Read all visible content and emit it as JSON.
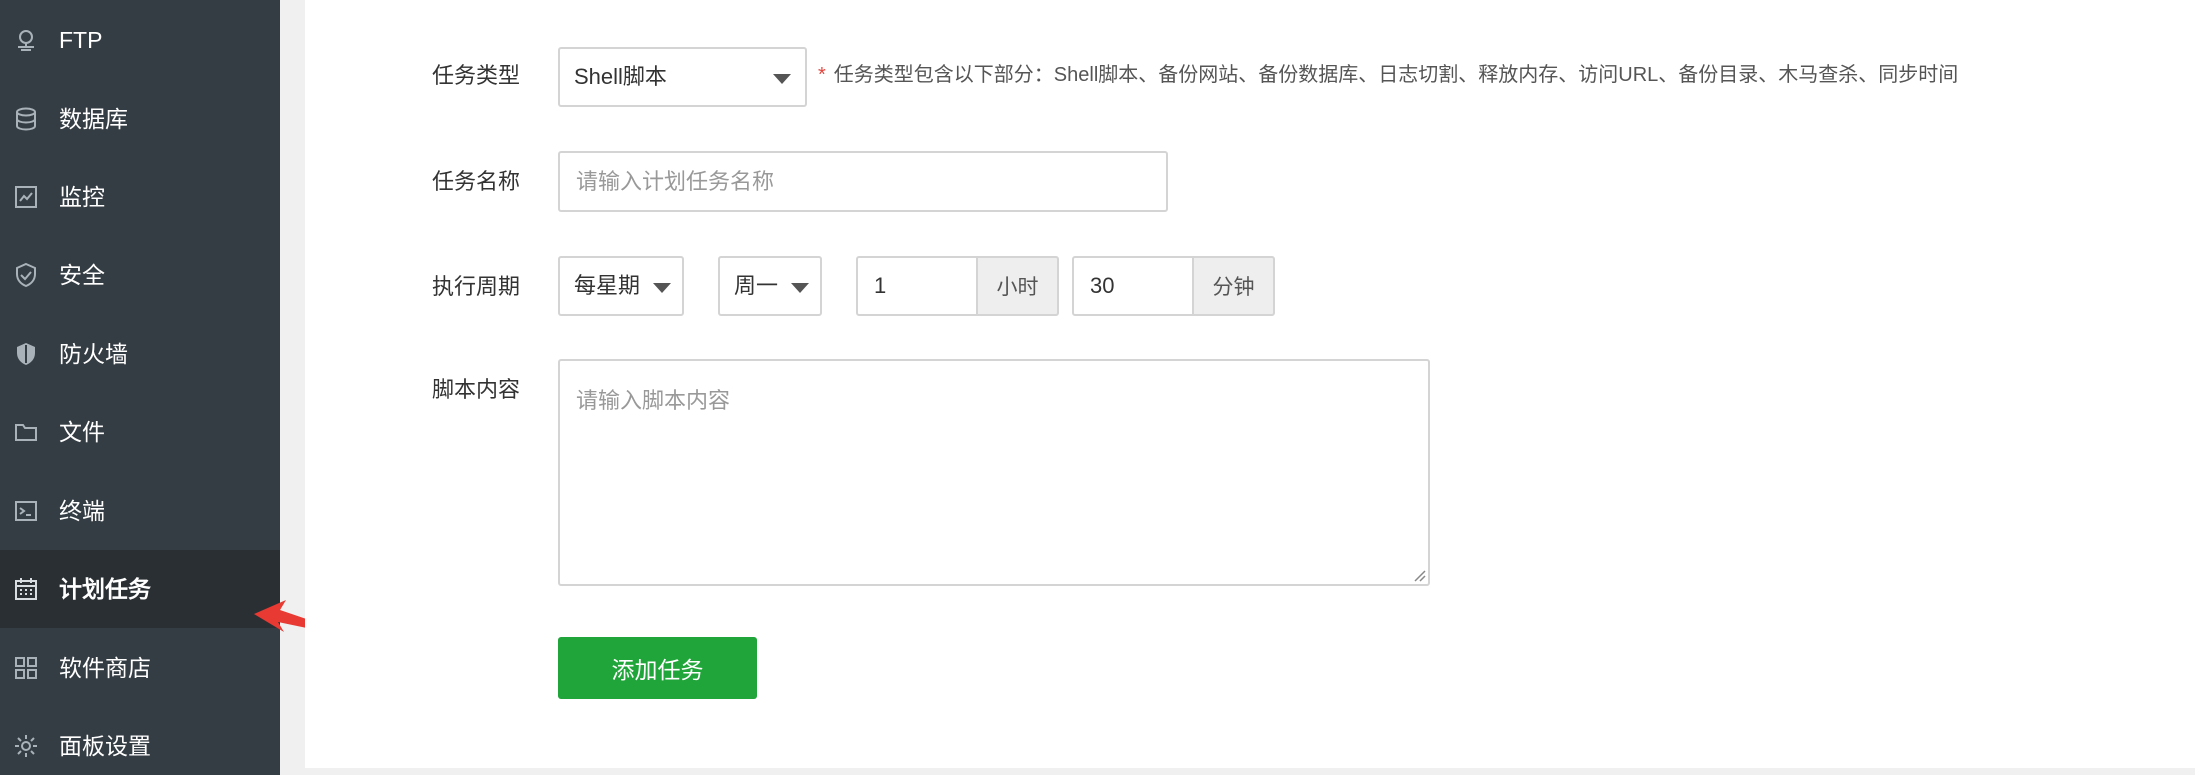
{
  "sidebar": {
    "items": [
      {
        "label": "FTP",
        "icon": "ftp-icon",
        "active": false
      },
      {
        "label": "数据库",
        "icon": "database-icon",
        "active": false
      },
      {
        "label": "监控",
        "icon": "monitor-icon",
        "active": false
      },
      {
        "label": "安全",
        "icon": "shield-check-icon",
        "active": false
      },
      {
        "label": "防火墙",
        "icon": "firewall-icon",
        "active": false
      },
      {
        "label": "文件",
        "icon": "folder-icon",
        "active": false
      },
      {
        "label": "终端",
        "icon": "terminal-icon",
        "active": false
      },
      {
        "label": "计划任务",
        "icon": "calendar-icon",
        "active": true
      },
      {
        "label": "软件商店",
        "icon": "apps-grid-icon",
        "active": false
      },
      {
        "label": "面板设置",
        "icon": "gear-icon",
        "active": false
      }
    ]
  },
  "form": {
    "task_type": {
      "label": "任务类型",
      "value": "Shell脚本",
      "hint_star": "*",
      "hint": "任务类型包含以下部分：Shell脚本、备份网站、备份数据库、日志切割、释放内存、访问URL、备份目录、木马查杀、同步时间"
    },
    "task_name": {
      "label": "任务名称",
      "placeholder": "请输入计划任务名称"
    },
    "period": {
      "label": "执行周期",
      "frequency": "每星期",
      "weekday": "周一",
      "hour": "1",
      "hour_unit": "小时",
      "minute": "30",
      "minute_unit": "分钟"
    },
    "script": {
      "label": "脚本内容",
      "placeholder": "请输入脚本内容"
    },
    "submit_label": "添加任务"
  },
  "colors": {
    "sidebar_bg": "#353d44",
    "sidebar_active_bg": "#2a2f34",
    "primary_button": "#20a53a",
    "annotation_arrow": "#e83a32",
    "required_star": "#e2463f"
  }
}
